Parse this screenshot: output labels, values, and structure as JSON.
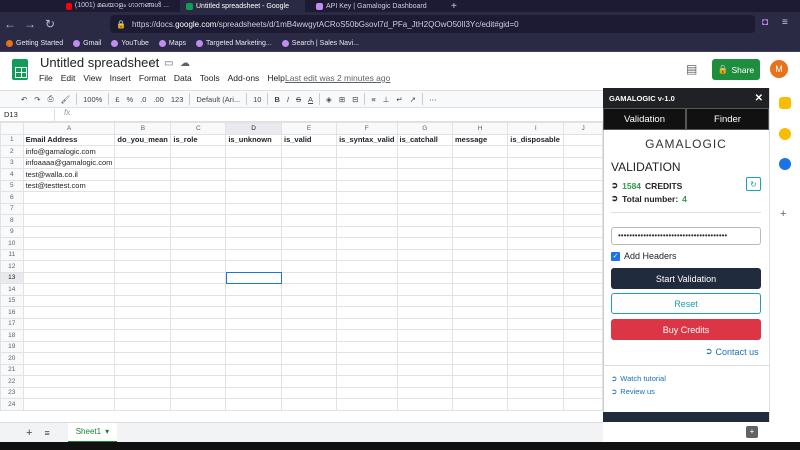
{
  "browser": {
    "tabs": [
      {
        "title": "(1001) മലയാളം ഗാനങ്ങൾ ...",
        "color": "#ff0000"
      },
      {
        "title": "Untitled spreadsheet - Google",
        "color": "#0f9d58",
        "active": true
      },
      {
        "title": "API Key | Gamalogic Dashboard",
        "color": "#c28bf0"
      }
    ],
    "new_tab": "+",
    "url_prefix": "https://docs.",
    "url_domain": "google.com",
    "url_rest": "/spreadsheets/d/1mB4wwgytACRoS50bGsovl7d_PFa_JtH2QOwO50Il3Yc/edit#gid=0",
    "bookmarks": [
      "Getting Started",
      "Gmail",
      "YouTube",
      "Maps",
      "Targeted Marketing...",
      "Search | Sales Navi..."
    ]
  },
  "sheets": {
    "title": "Untitled spreadsheet",
    "menu": [
      "File",
      "Edit",
      "View",
      "Insert",
      "Format",
      "Data",
      "Tools",
      "Add-ons",
      "Help"
    ],
    "last_edit": "Last edit was 2 minutes ago",
    "share_label": "Share",
    "avatar_initial": "M",
    "toolbar": {
      "zoom": "100%",
      "currency": "£",
      "percent": "%",
      "dec_less": ".0",
      "dec_more": ".00",
      "format": "123",
      "font": "Default (Ari...",
      "size": "10",
      "bold": "B",
      "italic": "I",
      "strike": "S",
      "textcolor": "A"
    },
    "name_box": "D13",
    "fx": "fx",
    "columns": [
      "A",
      "B",
      "C",
      "D",
      "E",
      "F",
      "G",
      "H",
      "I",
      "J"
    ],
    "selected_column": "D",
    "selected_row": "13",
    "header_row": [
      "Email Address",
      "do_you_mean",
      "is_role",
      "is_unknown",
      "is_valid",
      "is_syntax_valid",
      "is_catchall",
      "message",
      "is_disposable",
      ""
    ],
    "emails": [
      "info@gamalogic.com",
      "infoaaaa@gamalogic.com",
      "test@walla.co.il",
      "test@testtest.com"
    ],
    "row_count": 24,
    "sheet_tab": "Sheet1",
    "add_sheet": "+",
    "all_sheets": "≡"
  },
  "panel": {
    "header": "GAMALOGIC v-1.0",
    "close": "✕",
    "tabs": [
      "Validation",
      "Finder"
    ],
    "brand": "GAMALOGIC",
    "section_title": "VALIDATION",
    "credits_value": "1584",
    "credits_label": "CREDITS",
    "total_label": "Total number:",
    "total_value": "4",
    "api_key_masked": "•••••••••••••••••••••••••••••••••••••••",
    "add_headers_label": "Add Headers",
    "start_button": "Start Validation",
    "reset_button": "Reset",
    "buy_button": "Buy Credits",
    "contact_link": "Contact us",
    "watch_link": "Watch tutorial",
    "review_link": "Review us"
  },
  "colors": {
    "accent_green": "#1e8e3e",
    "panel_dark": "#202124",
    "buy_red": "#dc3545",
    "teal": "#1aa0b0",
    "link_blue": "#1a6fb5"
  }
}
